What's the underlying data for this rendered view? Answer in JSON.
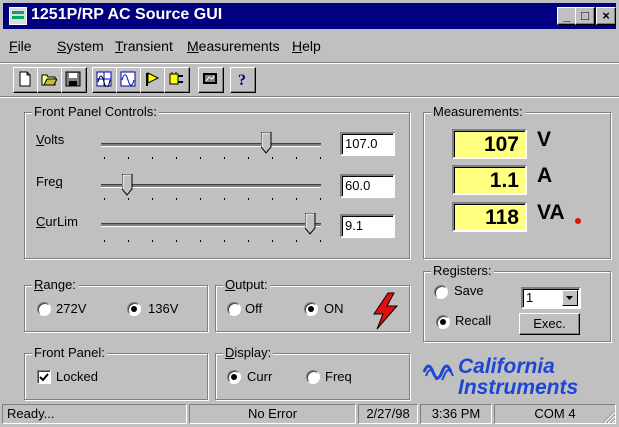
{
  "window": {
    "title": "1251P/RP AC Source GUI"
  },
  "title_buttons": {
    "minimize": "_",
    "maximize": "□",
    "close": "×"
  },
  "menu": [
    {
      "key": "F",
      "rest": "ile"
    },
    {
      "key": "S",
      "rest": "ystem"
    },
    {
      "key": "T",
      "rest": "ransient"
    },
    {
      "key": "M",
      "rest": "easurements"
    },
    {
      "key": "H",
      "rest": "elp"
    }
  ],
  "toolbar": {
    "icons": [
      "new-file-icon",
      "open-folder-icon",
      "save-icon",
      "waveform-grid-icon",
      "waveform-icon",
      "flag-icon",
      "plug-icon",
      "monitor-icon",
      "help-icon"
    ],
    "help_glyph": "?"
  },
  "front_panel_controls": {
    "label": "Front Panel Controls:",
    "volts": {
      "key": "V",
      "rest": "olts",
      "value": "107.0",
      "level": 0.76
    },
    "freq": {
      "key": "Fre",
      "underline": "q",
      "value": "60.0",
      "level": 0.1
    },
    "curlim": {
      "key": "C",
      "rest": "urLim",
      "value": "9.1",
      "level": 0.97
    }
  },
  "measurements": {
    "label": "Measurements:",
    "voltage": {
      "value": "107",
      "unit": "V"
    },
    "current": {
      "value": "1.1",
      "unit": "A"
    },
    "power": {
      "value": "118",
      "unit": "VA"
    }
  },
  "range": {
    "key": "R",
    "rest": "ange:",
    "options": [
      "272V",
      "136V"
    ],
    "selected": "136V"
  },
  "output": {
    "key": "O",
    "rest": "utput:",
    "options": [
      "Off",
      "ON"
    ],
    "selected": "ON"
  },
  "registers": {
    "label": "Registers:",
    "save": "Save",
    "recall": "Recall",
    "selected": "Recall",
    "register": "1",
    "exec": "Exec."
  },
  "front_panel": {
    "label": "Front Panel:",
    "locked_label": "Locked",
    "locked": true
  },
  "display": {
    "key": "D",
    "rest": "isplay:",
    "options": [
      "Curr",
      "Freq"
    ],
    "selected": "Curr"
  },
  "logo": {
    "line1": "California",
    "line2": "Instruments"
  },
  "statusbar": {
    "message": "Ready...",
    "error": "No Error",
    "date": "2/27/98",
    "time": "3:36 PM",
    "port": "COM 4"
  },
  "colors": {
    "title_bg": "#000080",
    "meas_bg": "#ffff80",
    "logo": "#1e46d2",
    "lightning": "#e01010",
    "led": "#e01010"
  }
}
